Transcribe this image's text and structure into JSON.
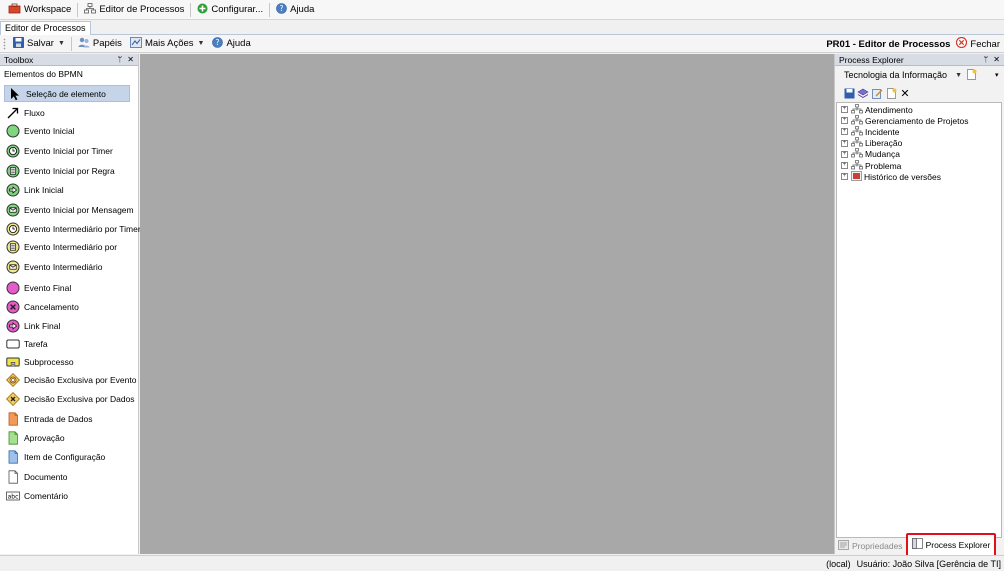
{
  "menubar": {
    "workspace": "Workspace",
    "process_editor": "Editor de Processos",
    "configure": "Configurar...",
    "help": "Ajuda"
  },
  "doc_tab": "Editor de Processos",
  "toolbar": {
    "save": "Salvar",
    "roles": "Papéis",
    "more_actions": "Mais Ações",
    "help": "Ajuda",
    "editor_title": "PR01 - Editor de Processos",
    "close": "Fechar"
  },
  "toolbox": {
    "title": "Toolbox",
    "group": "Elementos do BPMN",
    "items": [
      {
        "label": "Seleção de elemento",
        "icon": "pointer-icon"
      },
      {
        "label": "Fluxo",
        "icon": "flow-arrow-icon"
      },
      {
        "label": "Evento Inicial",
        "icon": "start-event-icon"
      },
      {
        "label": "Evento Inicial por Timer",
        "icon": "timer-start-event-icon"
      },
      {
        "label": "Evento Inicial por Regra",
        "icon": "rule-start-event-icon"
      },
      {
        "label": "Link Inicial",
        "icon": "link-start-event-icon"
      },
      {
        "label": "Evento Inicial por Mensagem",
        "icon": "message-start-event-icon"
      },
      {
        "label": "Evento Intermediário por Timer",
        "icon": "timer-intermediate-event-icon"
      },
      {
        "label": "Evento Intermediário por",
        "icon": "rule-intermediate-event-icon"
      },
      {
        "label": "Evento Intermediário",
        "icon": "message-intermediate-event-icon"
      },
      {
        "label": "Evento Final",
        "icon": "end-event-icon"
      },
      {
        "label": "Cancelamento",
        "icon": "cancel-end-event-icon"
      },
      {
        "label": "Link Final",
        "icon": "link-end-event-icon"
      },
      {
        "label": "Tarefa",
        "icon": "task-icon"
      },
      {
        "label": "Subprocesso",
        "icon": "subprocess-icon"
      },
      {
        "label": "Decisão Exclusiva por Evento",
        "icon": "event-gateway-icon"
      },
      {
        "label": "Decisão Exclusiva por Dados",
        "icon": "data-gateway-icon"
      },
      {
        "label": "Entrada de Dados",
        "icon": "data-input-icon"
      },
      {
        "label": "Aprovação",
        "icon": "approval-icon"
      },
      {
        "label": "Item de Configuração",
        "icon": "config-item-icon"
      },
      {
        "label": "Documento",
        "icon": "document-icon"
      },
      {
        "label": "Comentário",
        "icon": "comment-icon"
      }
    ]
  },
  "explorer": {
    "title": "Process Explorer",
    "selected_area": "Tecnologia da Informação",
    "tree": [
      "Atendimento",
      "Gerenciamento de Projetos",
      "Incidente",
      "Liberação",
      "Mudança",
      "Problema",
      "Histórico de versões"
    ],
    "tab_properties": "Propriedades",
    "tab_explorer": "Process Explorer"
  },
  "status": {
    "server": "(local)",
    "user": "Usuário: João Silva [Gerência de TI]"
  },
  "colors": {
    "start": "#7ed67e",
    "end": "#e75ac9",
    "intermediate": "#f3e98a",
    "highlight": "#e0101a",
    "canvas": "#a8a8a8"
  }
}
